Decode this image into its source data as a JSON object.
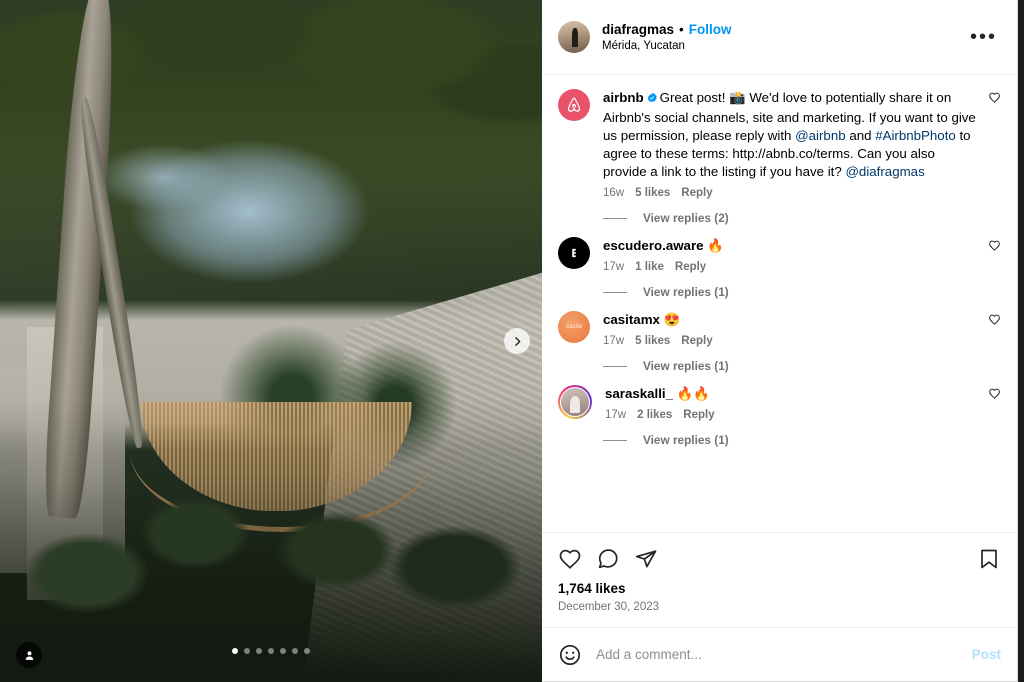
{
  "post": {
    "header": {
      "username": "diafragmas",
      "separator": "•",
      "follow_label": "Follow",
      "location": "Mérida, Yucatan",
      "more_label": "•••"
    },
    "media": {
      "alt": "Tropical courtyard with a woven hammock strung between a tree and a stone wall, surrounded by dense green foliage under a tree canopy",
      "next_arrow_icon": "chevron-right-icon",
      "tag_icon": "person-tag-icon",
      "carousel": {
        "total": 7,
        "active_index": 0
      }
    },
    "comments": [
      {
        "id": "airbnb",
        "username": "airbnb",
        "verified": true,
        "avatar_icon": "airbnb-logo-icon",
        "avatar_color": "#E8536A",
        "segments": [
          {
            "text": "Great post! 📸 We'd love to potentially share it on Airbnb's social channels, site and marketing. If you want to give us permission, please reply with ",
            "link": false
          },
          {
            "text": "@airbnb",
            "link": true
          },
          {
            "text": " and ",
            "link": false
          },
          {
            "text": "#AirbnbPhoto",
            "link": true
          },
          {
            "text": " to agree to these terms: http://abnb.co/terms. Can you also provide a link to the listing if you have it? ",
            "link": false
          },
          {
            "text": "@diafragmas",
            "link": true
          }
        ],
        "time": "16w",
        "likes": "5 likes",
        "reply": "Reply",
        "view_replies": "View replies (2)"
      },
      {
        "id": "escudero",
        "username": "escudero.aware",
        "verified": false,
        "avatar_icon": "escudero-logo-icon",
        "avatar_color": "#000000",
        "segments": [
          {
            "text": "🔥",
            "link": false
          }
        ],
        "time": "17w",
        "likes": "1 like",
        "reply": "Reply",
        "view_replies": "View replies (1)"
      },
      {
        "id": "casitamx",
        "username": "casitamx",
        "verified": false,
        "avatar_icon": "casitamx-logo-icon",
        "avatar_color": "#E8763C",
        "segments": [
          {
            "text": "😍",
            "link": false
          }
        ],
        "time": "17w",
        "likes": "5 likes",
        "reply": "Reply",
        "view_replies": "View replies (1)"
      },
      {
        "id": "saraskalli",
        "username": "saraskalli_",
        "verified": false,
        "avatar_icon": "user-photo-avatar",
        "avatar_color": "#B9A7A0",
        "has_story_ring": true,
        "segments": [
          {
            "text": "🔥🔥",
            "link": false
          }
        ],
        "time": "17w",
        "likes": "2 likes",
        "reply": "Reply",
        "view_replies": "View replies (1)"
      }
    ],
    "actions": {
      "like_icon": "heart-icon",
      "comment_icon": "comment-bubble-icon",
      "share_icon": "share-paper-plane-icon",
      "save_icon": "bookmark-icon",
      "likes_count": "1,764 likes",
      "date": "December 30, 2023"
    },
    "add_comment": {
      "emoji_icon": "emoji-smiley-icon",
      "placeholder": "Add a comment...",
      "post_label": "Post",
      "value": ""
    }
  },
  "colors": {
    "link_blue": "#00376b",
    "follow_blue": "#0095f6",
    "post_blue_disabled": "#b2dffc",
    "verified_blue": "#0095f6",
    "airbnb_coral": "#E8536A",
    "muted_text": "#737373"
  }
}
